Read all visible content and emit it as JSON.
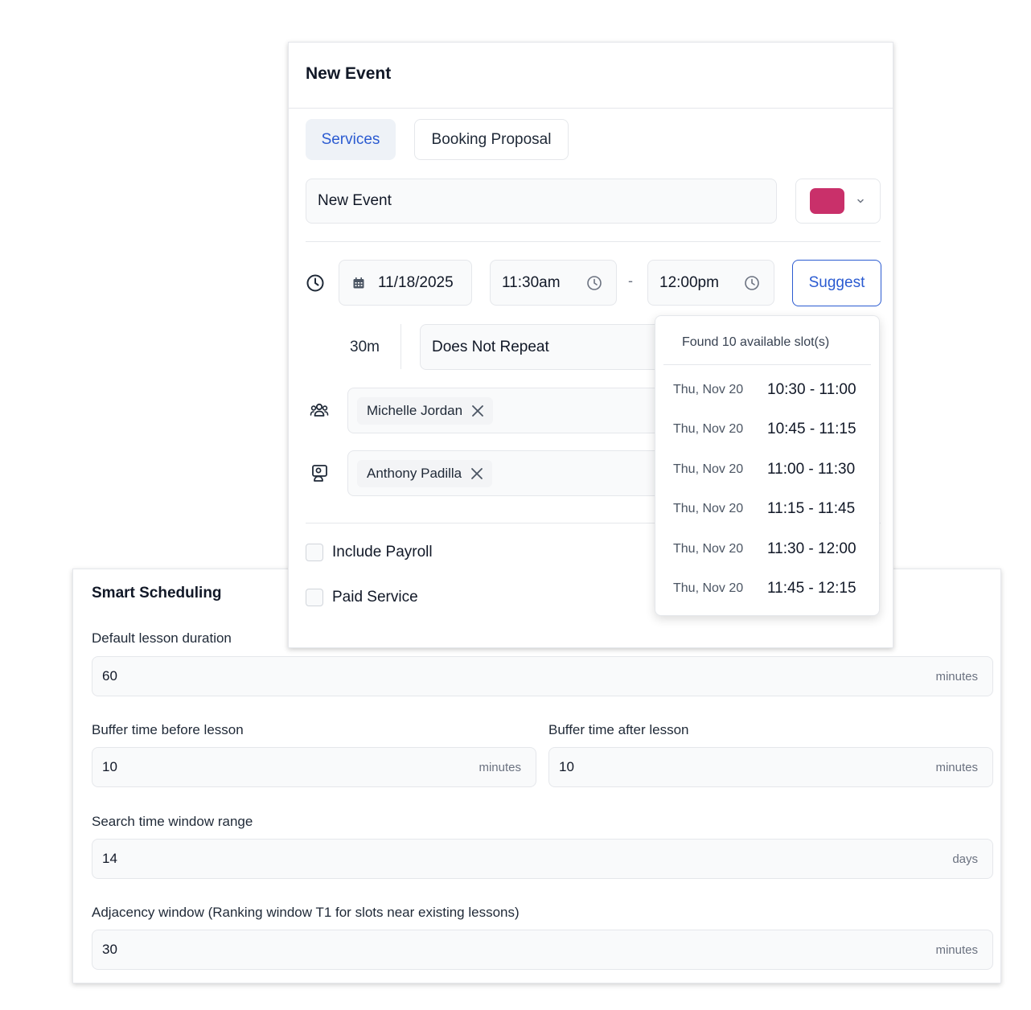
{
  "modal": {
    "title": "New Event",
    "tabs": [
      {
        "label": "Services",
        "active": true
      },
      {
        "label": "Booking Proposal",
        "active": false
      }
    ],
    "event_name_value": "New Event",
    "color_swatch": "#c9306a",
    "date_value": "11/18/2025",
    "start_time": "11:30am",
    "time_separator": "-",
    "end_time": "12:00pm",
    "suggest_label": "Suggest",
    "duration": "30m",
    "repeat_value": "Does Not Repeat",
    "attendee_chip": "Michelle Jordan",
    "instructor_chip": "Anthony Padilla",
    "include_payroll_label": "Include Payroll",
    "paid_service_label": "Paid Service"
  },
  "slots": {
    "found_text": "Found 10 available slot(s)",
    "items": [
      {
        "date": "Thu, Nov 20",
        "time": "10:30 - 11:00"
      },
      {
        "date": "Thu, Nov 20",
        "time": "10:45 - 11:15"
      },
      {
        "date": "Thu, Nov 20",
        "time": "11:00 - 11:30"
      },
      {
        "date": "Thu, Nov 20",
        "time": "11:15 - 11:45"
      },
      {
        "date": "Thu, Nov 20",
        "time": "11:30 - 12:00"
      },
      {
        "date": "Thu, Nov 20",
        "time": "11:45 - 12:15"
      }
    ]
  },
  "settings": {
    "title": "Smart Scheduling",
    "default_duration": {
      "label": "Default lesson duration",
      "value": "60",
      "unit": "minutes"
    },
    "buffer_before": {
      "label": "Buffer time before lesson",
      "value": "10",
      "unit": "minutes"
    },
    "buffer_after": {
      "label": "Buffer time after lesson",
      "value": "10",
      "unit": "minutes"
    },
    "search_window": {
      "label": "Search time window range",
      "value": "14",
      "unit": "days"
    },
    "adjacency_window": {
      "label": "Adjacency window (Ranking window T1 for slots near existing lessons)",
      "value": "30",
      "unit": "minutes"
    }
  }
}
